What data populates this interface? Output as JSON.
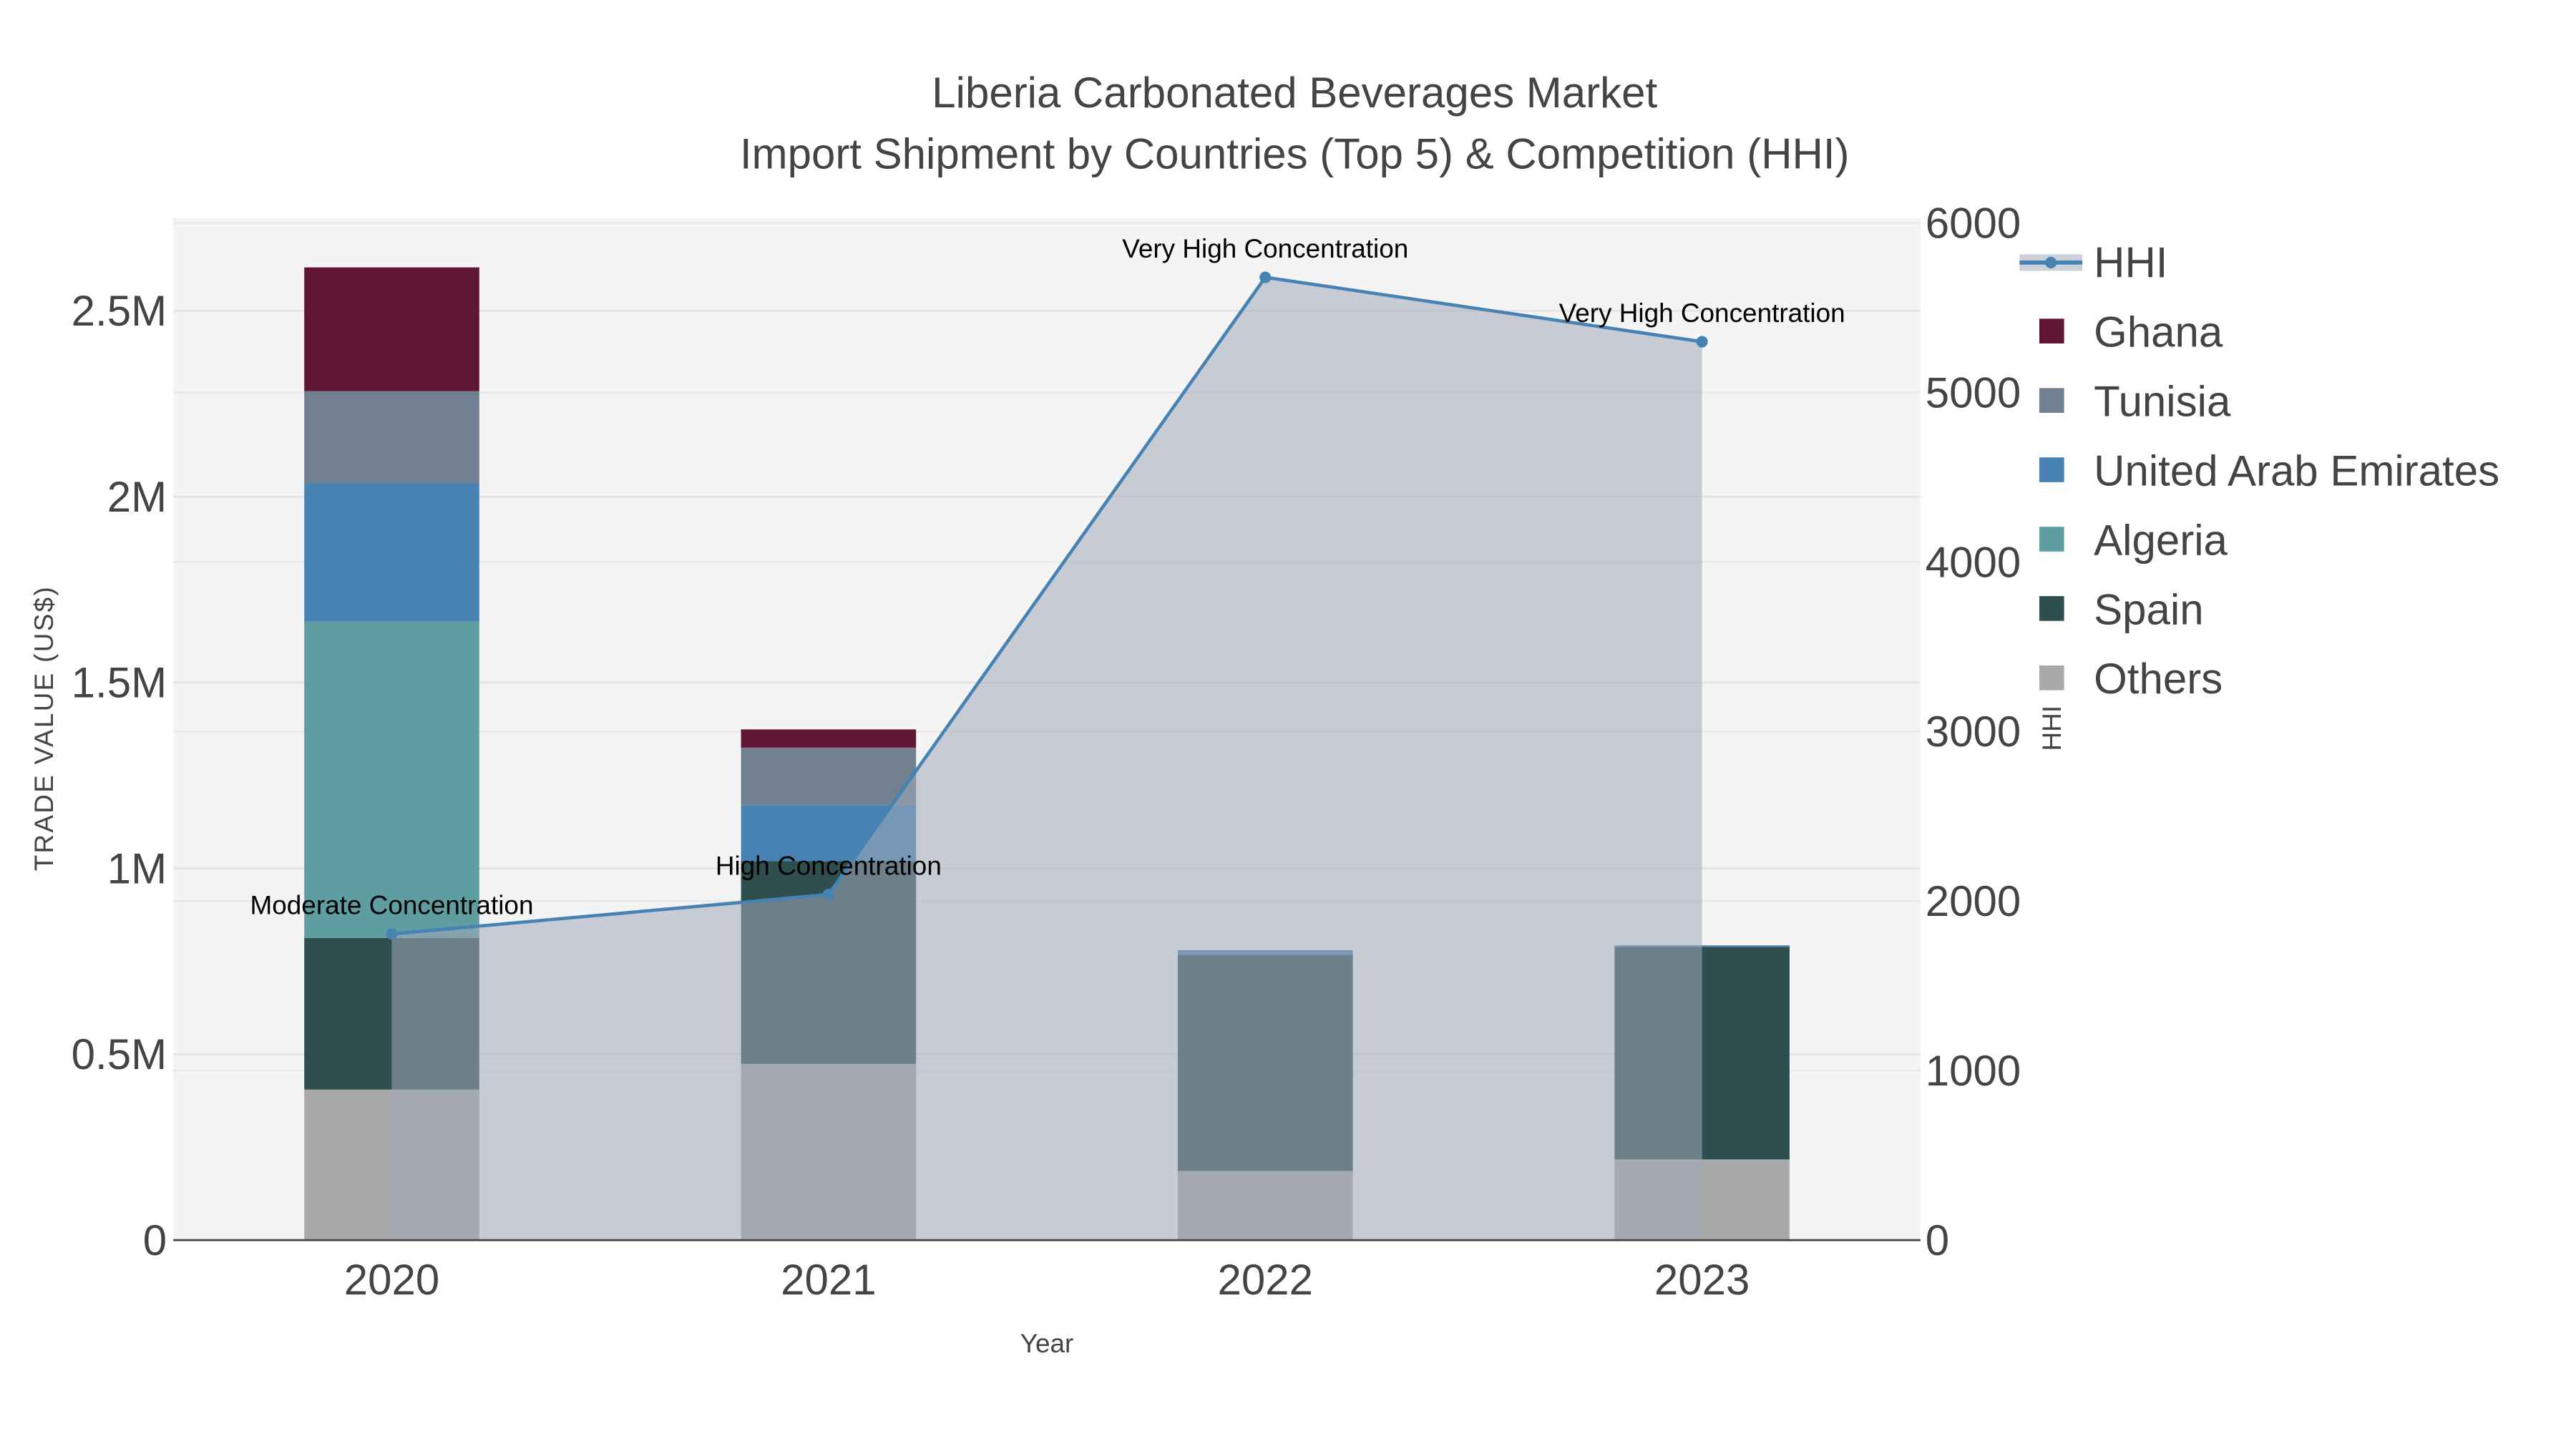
{
  "chart_data": {
    "type": "bar",
    "title": "Liberia Carbonated Beverages Market",
    "subtitle": "Import Shipment by Countries (Top 5) & Competition (HHI)",
    "xlabel": "Year",
    "ylabel": "TRADE VALUE (US$)",
    "y2label": "HHI",
    "categories": [
      "2020",
      "2021",
      "2022",
      "2023"
    ],
    "ylim": [
      0,
      2750000
    ],
    "y2lim": [
      0,
      6000
    ],
    "yticks": [
      {
        "v": 0,
        "label": "0"
      },
      {
        "v": 500000,
        "label": "0.5M"
      },
      {
        "v": 1000000,
        "label": "1M"
      },
      {
        "v": 1500000,
        "label": "1.5M"
      },
      {
        "v": 2000000,
        "label": "2M"
      },
      {
        "v": 2500000,
        "label": "2.5M"
      }
    ],
    "y2ticks": [
      {
        "v": 0,
        "label": "0"
      },
      {
        "v": 1000,
        "label": "1000"
      },
      {
        "v": 2000,
        "label": "2000"
      },
      {
        "v": 3000,
        "label": "3000"
      },
      {
        "v": 4000,
        "label": "4000"
      },
      {
        "v": 5000,
        "label": "5000"
      },
      {
        "v": 6000,
        "label": "6000"
      }
    ],
    "grid": true,
    "legend_position": "right",
    "series": [
      {
        "name": "Others",
        "color": "#a9a9a9",
        "values": [
          405000,
          474000,
          186000,
          217000
        ]
      },
      {
        "name": "Spain",
        "color": "#2f4f4f",
        "values": [
          408000,
          546000,
          581000,
          572000
        ]
      },
      {
        "name": "Algeria",
        "color": "#5f9ea0",
        "values": [
          851000,
          0,
          0,
          0
        ]
      },
      {
        "name": "United Arab Emirates",
        "color": "#4682b4",
        "values": [
          372000,
          150000,
          13000,
          4000
        ]
      },
      {
        "name": "Tunisia",
        "color": "#708090",
        "values": [
          248000,
          155000,
          0,
          0
        ]
      },
      {
        "name": "Ghana",
        "color": "#601535",
        "values": [
          333000,
          49000,
          0,
          0
        ]
      }
    ],
    "hhi": {
      "name": "HHI",
      "color": "#4682b4",
      "values": [
        1806,
        2039,
        5680,
        5300
      ],
      "annotations": [
        "Moderate Concentration",
        "High Concentration",
        "Very High Concentration",
        "Very High Concentration"
      ]
    }
  }
}
